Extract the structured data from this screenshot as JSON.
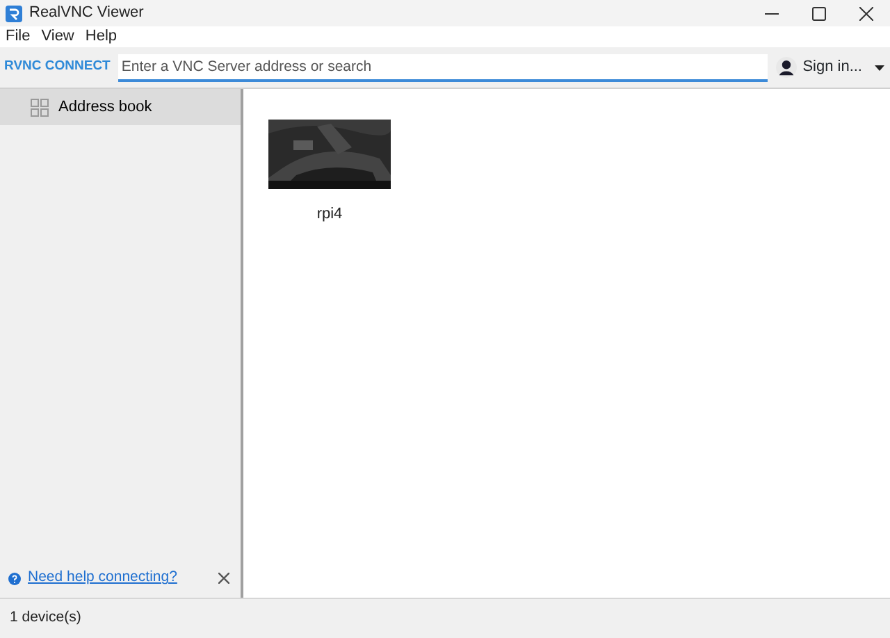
{
  "window": {
    "title": "RealVNC Viewer"
  },
  "menu": [
    "File",
    "View",
    "Help"
  ],
  "toolbar": {
    "logo": "RVNC CONNECT",
    "search": {
      "placeholder": "Enter a VNC Server address or search"
    },
    "sign_in": "Sign in..."
  },
  "sidebar": {
    "items": [
      {
        "label": "Address book",
        "selected": true
      }
    ],
    "help_link": "Need help connecting?"
  },
  "devices": [
    {
      "name": "rpi4",
      "kind": "picture"
    }
  ],
  "status_bar": "1 device(s)"
}
